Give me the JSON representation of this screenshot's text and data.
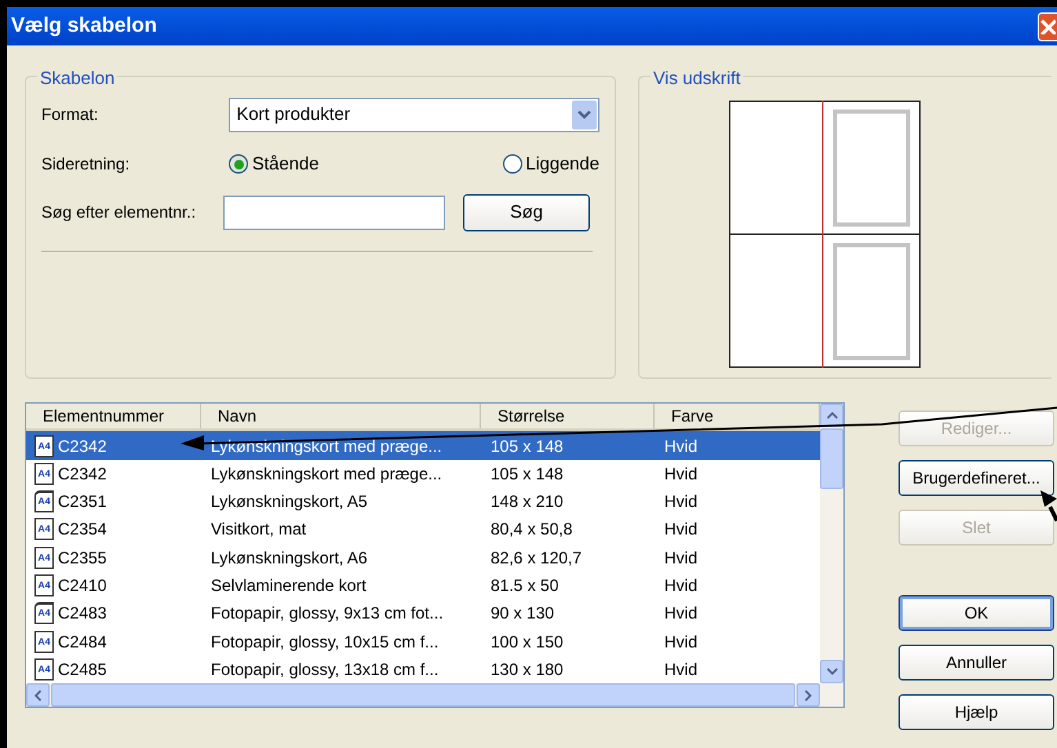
{
  "window": {
    "title": "Vælg skabelon"
  },
  "template_group": {
    "title": "Skabelon",
    "format_label": "Format:",
    "format_value": "Kort produkter",
    "orientation_label": "Sideretning:",
    "orientation_options": [
      {
        "label": "Stående",
        "selected": true
      },
      {
        "label": "Liggende",
        "selected": false
      }
    ],
    "search_label": "Søg efter elementnr.:",
    "search_button": "Søg"
  },
  "preview_group": {
    "title": "Vis udskrift"
  },
  "table": {
    "columns": [
      "Elementnummer",
      "Navn",
      "Størrelse",
      "Farve"
    ],
    "rows": [
      {
        "kind": "single",
        "icon_text": "A4",
        "selected": true,
        "cells": [
          "C2342",
          "Lykønskningskort med præge...",
          "105 x 148",
          "Hvid"
        ]
      },
      {
        "kind": "single",
        "icon_text": "A4",
        "selected": false,
        "cells": [
          "C2342",
          "Lykønskningskort med præge...",
          "105 x 148",
          "Hvid"
        ]
      },
      {
        "kind": "folded",
        "icon_text": "A4",
        "selected": false,
        "cells": [
          "C2351",
          "Lykønskningskort, A5",
          "148 x 210",
          "Hvid"
        ]
      },
      {
        "kind": "single",
        "icon_text": "A4",
        "selected": false,
        "cells": [
          "C2354",
          "Visitkort, mat",
          "80,4 x 50,8",
          "Hvid"
        ]
      },
      {
        "kind": "single",
        "icon_text": "A4",
        "selected": false,
        "cells": [
          "C2355",
          "Lykønskningskort, A6",
          "82,6 x 120,7",
          "Hvid"
        ]
      },
      {
        "kind": "single",
        "icon_text": "A4",
        "selected": false,
        "cells": [
          "C2410",
          "Selvlaminerende kort",
          "81.5 x 50",
          "Hvid"
        ]
      },
      {
        "kind": "folded",
        "icon_text": "A4",
        "selected": false,
        "cells": [
          "C2483",
          "Fotopapir, glossy, 9x13 cm fot...",
          "90 x 130",
          "Hvid"
        ]
      },
      {
        "kind": "single",
        "icon_text": "A4",
        "selected": false,
        "cells": [
          "C2484",
          "Fotopapir, glossy, 10x15 cm f...",
          "100 x 150",
          "Hvid"
        ]
      },
      {
        "kind": "single",
        "icon_text": "A4",
        "selected": false,
        "cells": [
          "C2485",
          "Fotopapir, glossy, 13x18 cm f...",
          "130 x 180",
          "Hvid"
        ]
      }
    ]
  },
  "buttons": [
    {
      "label": "Rediger...",
      "disabled": true,
      "default": false
    },
    {
      "label": "Brugerdefineret...",
      "disabled": false,
      "default": false
    },
    {
      "label": "Slet",
      "disabled": true,
      "default": false
    },
    {
      "label": "OK",
      "disabled": false,
      "default": true
    },
    {
      "label": "Annuller",
      "disabled": false,
      "default": false
    },
    {
      "label": "Hjælp",
      "disabled": false,
      "default": false
    }
  ]
}
